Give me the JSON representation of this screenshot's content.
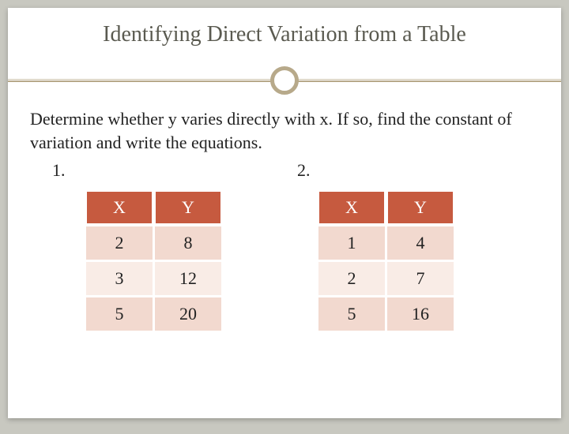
{
  "title": "Identifying Direct Variation from a Table",
  "instruction": "Determine whether y varies directly with x. If so, find the constant of variation and write the equations.",
  "problems": [
    {
      "num": "1.",
      "headers": [
        "X",
        "Y"
      ],
      "rows": [
        [
          "2",
          "8"
        ],
        [
          "3",
          "12"
        ],
        [
          "5",
          "20"
        ]
      ]
    },
    {
      "num": "2.",
      "headers": [
        "X",
        "Y"
      ],
      "rows": [
        [
          "1",
          "4"
        ],
        [
          "2",
          "7"
        ],
        [
          "5",
          "16"
        ]
      ]
    }
  ],
  "chart_data": [
    {
      "type": "table",
      "title": "Problem 1",
      "columns": [
        "X",
        "Y"
      ],
      "rows": [
        [
          2,
          8
        ],
        [
          3,
          12
        ],
        [
          5,
          20
        ]
      ]
    },
    {
      "type": "table",
      "title": "Problem 2",
      "columns": [
        "X",
        "Y"
      ],
      "rows": [
        [
          1,
          4
        ],
        [
          2,
          7
        ],
        [
          5,
          16
        ]
      ]
    }
  ]
}
